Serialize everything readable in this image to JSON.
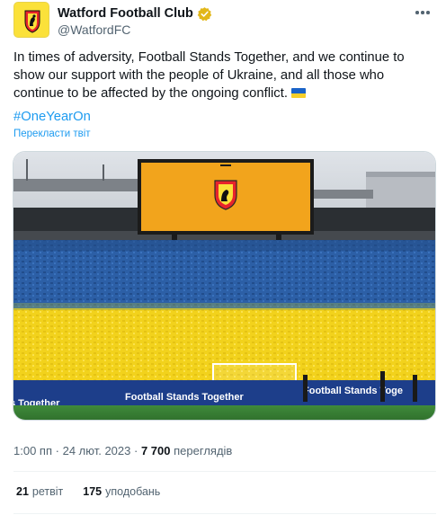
{
  "account": {
    "name": "Watford Football Club",
    "handle": "@WatfordFC",
    "verified_color": "#e2b719"
  },
  "tweet": {
    "text": "In times of adversity, Football Stands Together, and we continue to show our support with the people of Ukraine, and all those who continue to be affected by the ongoing conflict.",
    "flag_icon": "ukraine-flag-icon",
    "hashtag": "#OneYearOn",
    "translate_label": "Перекласти твіт"
  },
  "photo": {
    "banner_left": "Football Stands Together",
    "banner_right": "Football Stands Toge",
    "banner_edge": "s Together"
  },
  "meta": {
    "time": "1:00 пп",
    "separator": "·",
    "date": "24 лют. 2023",
    "views_count": "7 700",
    "views_label": "переглядів"
  },
  "stats": {
    "retweets_count": "21",
    "retweets_label": "ретвіт",
    "likes_count": "175",
    "likes_label": "уподобань"
  },
  "colors": {
    "link": "#1d9bf0",
    "secondary_text": "#536471",
    "watford_yellow": "#fbe13a",
    "ukraine_blue": "#1a63c8",
    "ukraine_yellow": "#f7cf2a"
  }
}
